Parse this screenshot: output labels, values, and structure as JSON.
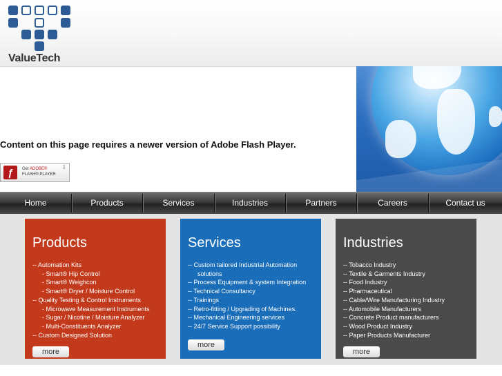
{
  "logo": {
    "text": "ValueTech",
    "accent": "#2d5b96"
  },
  "flash": {
    "message": "Content on this page requires a newer version of Adobe Flash Player.",
    "badge_line1_a": "Get ",
    "badge_line1_b": "ADOBE®",
    "badge_line2": "FLASH® PLAYER",
    "badge_icon": "flash-player-icon"
  },
  "nav": {
    "items": [
      "Home",
      "Products",
      "Services",
      "Industries",
      "Partners",
      "Careers",
      "Contact us"
    ]
  },
  "panels": {
    "products": {
      "title": "Products",
      "color": "#c23a1b",
      "items": [
        {
          "text": "--   Automation Kits",
          "sub": false
        },
        {
          "text": "- Smart® Hip Control",
          "sub": true
        },
        {
          "text": "- Smart® Weighcon",
          "sub": true
        },
        {
          "text": "- Smart® Dryer / Moisture Control",
          "sub": true
        },
        {
          "text": "--   Quality Testing & Control Instruments",
          "sub": false
        },
        {
          "text": "- Microwave  Measurement Instruments",
          "sub": true
        },
        {
          "text": "- Sugar / Nicotine / Moisture Analyzer",
          "sub": true
        },
        {
          "text": "- Multi-Constituents Analyzer",
          "sub": true
        },
        {
          "text": "--   Custom Designed Solution",
          "sub": false
        }
      ],
      "more": "more"
    },
    "services": {
      "title": "Services",
      "color": "#1a6db8",
      "items": [
        {
          "text": "--   Custom tailored Industrial Automation",
          "sub": false
        },
        {
          "text": "solutions",
          "sub": true
        },
        {
          "text": "--   Process Equipment & system Integration",
          "sub": false
        },
        {
          "text": "--   Technical Consultancy",
          "sub": false
        },
        {
          "text": "--   Trainings",
          "sub": false
        },
        {
          "text": "--   Retro-fitting / Upgrading of Machines.",
          "sub": false
        },
        {
          "text": "--   Mechanical Engineering services",
          "sub": false
        },
        {
          "text": "--   24/7 Service Support possibility",
          "sub": false
        }
      ],
      "more": "more"
    },
    "industries": {
      "title": "Industries",
      "color": "#4a4a4a",
      "items": [
        {
          "text": "--   Tobacco Industry",
          "sub": false
        },
        {
          "text": "--   Textile & Garments Industry",
          "sub": false
        },
        {
          "text": "--   Food Industry",
          "sub": false
        },
        {
          "text": "--   Pharmaceutical",
          "sub": false
        },
        {
          "text": "--   Cable/Wire Manufacturing Industry",
          "sub": false
        },
        {
          "text": "--   Automobile Manufacturers",
          "sub": false
        },
        {
          "text": "--   Concrete Product manufacturers",
          "sub": false
        },
        {
          "text": "--   Wood Product Industry",
          "sub": false
        },
        {
          "text": "--   Paper Products Manufacturer",
          "sub": false
        }
      ],
      "more": "more"
    }
  }
}
